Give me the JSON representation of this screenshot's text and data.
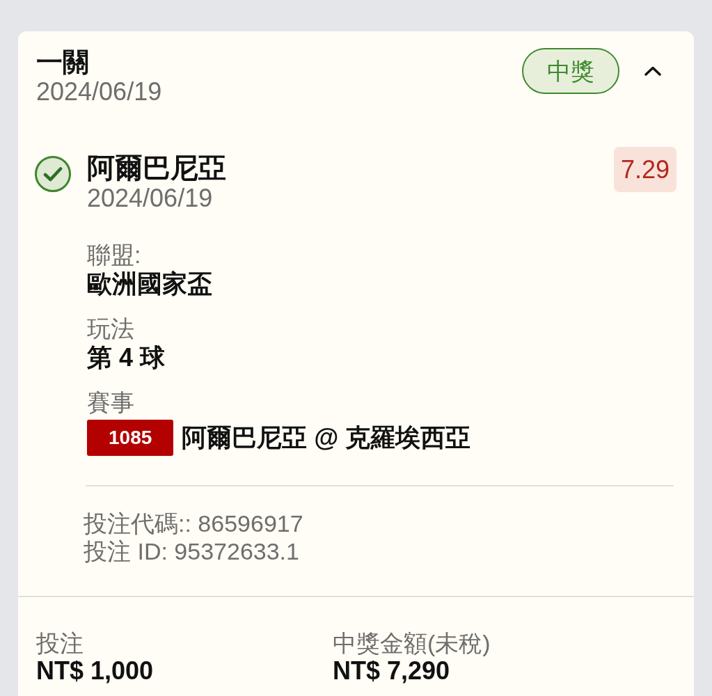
{
  "bet": {
    "type": "一關",
    "date": "2024/06/19",
    "status": {
      "label": "中獎",
      "kind": "won"
    },
    "expanded": true
  },
  "selections": [
    {
      "name": "阿爾巴尼亞",
      "date": "2024/06/19",
      "kind": "won",
      "odds": "7.29",
      "fields": [
        {
          "label": "聯盟:",
          "value": "歐洲國家盃"
        },
        {
          "label": "玩法",
          "value": "第 4 球"
        }
      ],
      "event": {
        "label": "賽事",
        "code": "1085",
        "match": "阿爾巴尼亞 @ 克羅埃西亞"
      },
      "ids": [
        "投注代碼:: 86596917",
        "投注 ID: 95372633.1"
      ]
    }
  ],
  "summary": [
    {
      "label": "投注",
      "value": "NT$ 1,000"
    },
    {
      "label": "中獎金額(未稅)",
      "value": "NT$ 7,290"
    }
  ]
}
